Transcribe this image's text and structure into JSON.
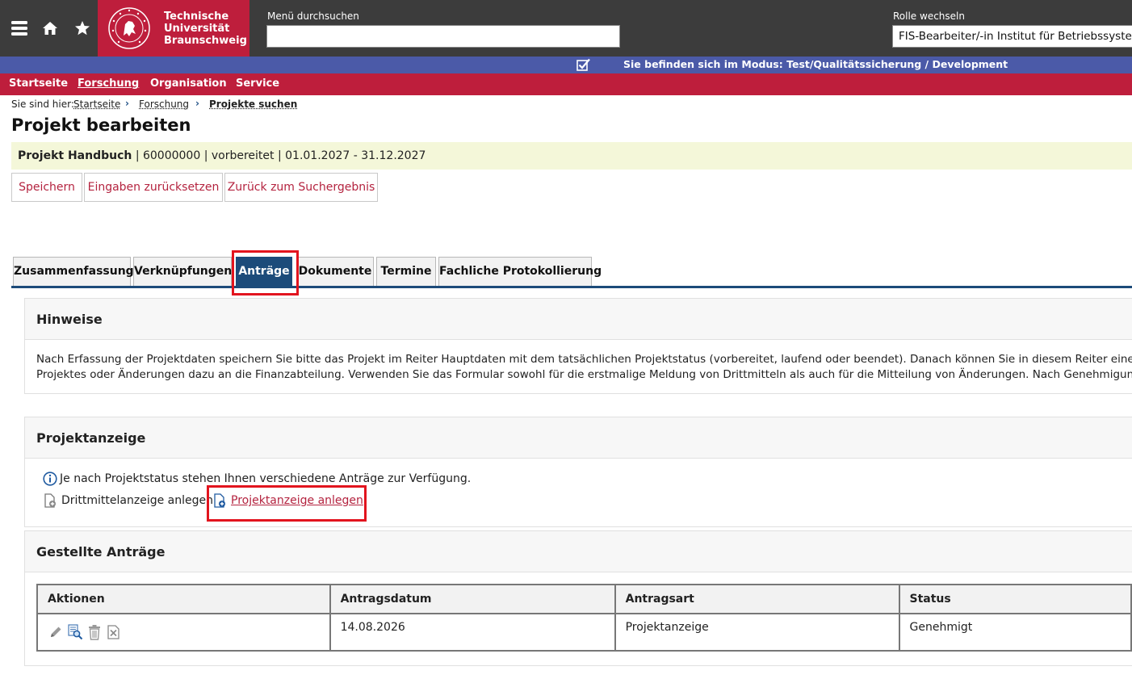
{
  "header": {
    "menu_icon": "hamburger-icon",
    "home_icon": "home-icon",
    "favorite_icon": "star-icon",
    "logo_lines": [
      "Technische",
      "Universität",
      "Braunschweig"
    ],
    "search_label": "Menü durchsuchen",
    "search_value": "",
    "role_label": "Rolle wechseln",
    "role_value": "FIS-Bearbeiter/-in Institut für Betriebssysteme"
  },
  "mode_bar": {
    "icon": "checkbox-checked-icon",
    "text": "Sie befinden sich im Modus: Test/Qualitätssicherung / Development"
  },
  "nav": {
    "items": [
      {
        "label": "Startseite",
        "active": false
      },
      {
        "label": "Forschung",
        "active": true
      },
      {
        "label": "Organisation",
        "active": false
      },
      {
        "label": "Service",
        "active": false
      }
    ]
  },
  "breadcrumb": {
    "prefix": "Sie sind hier:",
    "items": [
      "Startseite",
      "Forschung",
      "Projekte suchen"
    ]
  },
  "page": {
    "title": "Projekt bearbeiten",
    "project_name": "Projekt Handbuch",
    "project_meta": " | 60000000 | vorbereitet | 01.01.2027 - 31.12.2027"
  },
  "actions": {
    "save": "Speichern",
    "reset": "Eingaben zurücksetzen",
    "back": "Zurück zum Suchergebnis"
  },
  "tabs": [
    {
      "label": "Zusammenfassung",
      "active": false
    },
    {
      "label": "Verknüpfungen",
      "active": false
    },
    {
      "label": "Anträge",
      "active": true
    },
    {
      "label": "Dokumente",
      "active": false
    },
    {
      "label": "Termine",
      "active": false
    },
    {
      "label": "Fachliche Protokollierung",
      "active": false
    }
  ],
  "hinweise": {
    "title": "Hinweise",
    "line1": "Nach Erfassung der Projektdaten speichern Sie bitte das Projekt im Reiter Hauptdaten mit dem tatsächlichen Projektstatus (vorbereitet, laufend oder beendet). Danach können Sie in diesem Reiter eine Projekta",
    "line2": "Projektes oder Änderungen dazu an die Finanzabteilung. Verwenden Sie das Formular sowohl für die erstmalige Meldung von Drittmitteln als auch für die Mitteilung von Änderungen. Nach Genehmigung wird f"
  },
  "projektanzeige": {
    "title": "Projektanzeige",
    "info_icon": "info-icon",
    "info_text": "Je nach Projektstatus stehen Ihnen verschiedene Anträge zur Verfügung.",
    "drittmittel_label": "Drittmittelanzeige anlegen",
    "drittmittel_icon": "document-add-icon",
    "projektanzeige_label": "Projektanzeige anlegen",
    "projektanzeige_icon": "document-add-icon"
  },
  "gestellte": {
    "title": "Gestellte Anträge",
    "columns": [
      "Aktionen",
      "Antragsdatum",
      "Antragsart",
      "Status"
    ],
    "rows": [
      {
        "action_icons": [
          "edit-icon",
          "view-icon",
          "delete-icon",
          "cancel-icon"
        ],
        "antragsdatum": "14.08.2026",
        "antragsart": "Projektanzeige",
        "status": "Genehmigt"
      }
    ]
  },
  "colors": {
    "brand_red": "#be1e3c",
    "topbar": "#3c3c3c",
    "mode_bar": "#4b5aa8",
    "tab_active": "#1c4b7a",
    "highlight_box": "#e2141e",
    "info_bar": "#f4f7d9"
  }
}
